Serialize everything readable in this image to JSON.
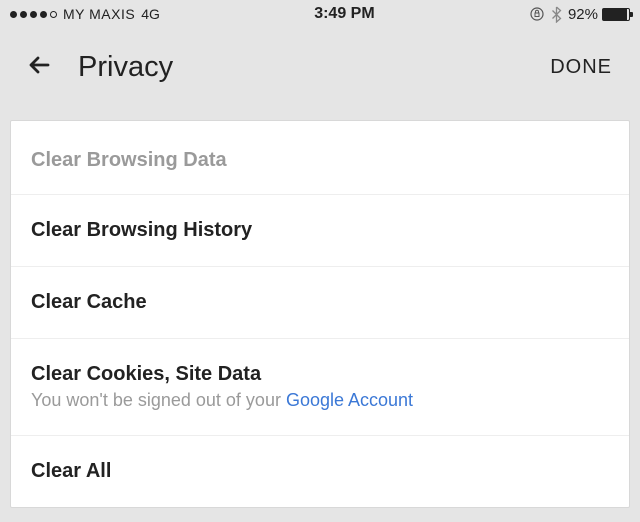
{
  "status": {
    "carrier": "MY MAXIS",
    "network": "4G",
    "time": "3:49 PM",
    "battery_pct": "92%"
  },
  "header": {
    "title": "Privacy",
    "done": "DONE"
  },
  "section": {
    "header": "Clear Browsing Data",
    "rows": [
      {
        "title": "Clear Browsing History"
      },
      {
        "title": "Clear Cache"
      },
      {
        "title": "Clear Cookies, Site Data",
        "sub_prefix": "You won't be signed out of your ",
        "sub_link": "Google Account"
      },
      {
        "title": "Clear All"
      }
    ]
  }
}
